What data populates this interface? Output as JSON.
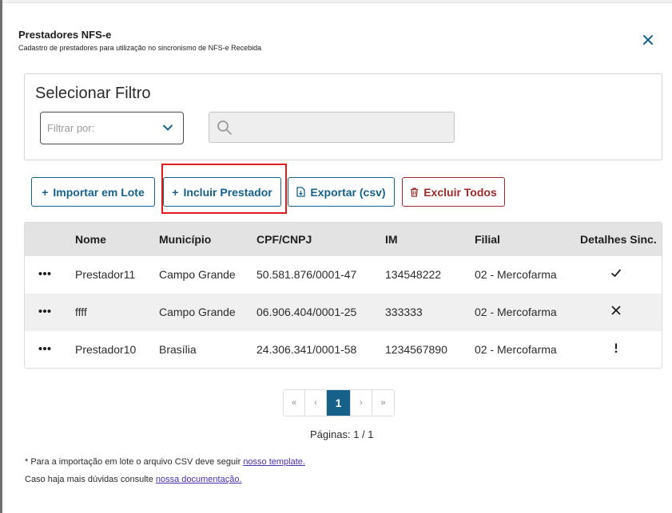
{
  "modal": {
    "title": "Prestadores NFS-e",
    "subtitle": "Cadastro de prestadores para utilização no sincronismo de NFS-e Recebida",
    "close_icon": "close-icon"
  },
  "filter": {
    "title": "Selecionar Filtro",
    "select_placeholder": "Filtrar por:",
    "search_value": "",
    "search_placeholder": ""
  },
  "actions": {
    "import_label": "Importar em Lote",
    "include_label": "Incluir Prestador",
    "export_label": "Exportar (csv)",
    "delete_all_label": "Excluir Todos",
    "plus_symbol": "+"
  },
  "table": {
    "headers": [
      "Nome",
      "Município",
      "CPF/CNPJ",
      "IM",
      "Filial",
      "Detalhes Sinc."
    ],
    "rows": [
      {
        "nome": "Prestador11",
        "municipio": "Campo Grande",
        "cnpj": "50.581.876/0001-47",
        "im": "134548222",
        "filial": "02 - Mercofarma",
        "status_icon": "check-icon"
      },
      {
        "nome": "ffff",
        "municipio": "Campo Grande",
        "cnpj": "06.906.404/0001-25",
        "im": "333333",
        "filial": "02 - Mercofarma",
        "status_icon": "x-icon"
      },
      {
        "nome": "Prestador10",
        "municipio": "Brasília",
        "cnpj": "24.306.341/0001-58",
        "im": "1234567890",
        "filial": "02 - Mercofarma",
        "status_icon": "exclamation-icon"
      }
    ]
  },
  "pagination": {
    "first": "«",
    "prev": "‹",
    "current": "1",
    "next": "›",
    "last": "»",
    "pages_text": "Páginas: 1 / 1"
  },
  "footer": {
    "note1_prefix": "* Para a importação em lote o arquivo CSV deve seguir ",
    "note1_link": "nosso template.",
    "note2_prefix": "Caso haja mais dúvidas consulte ",
    "note2_link": "nossa documentação."
  },
  "colors": {
    "primary": "#16618a",
    "danger": "#9b2a2a",
    "highlight": "#e01b1b"
  }
}
